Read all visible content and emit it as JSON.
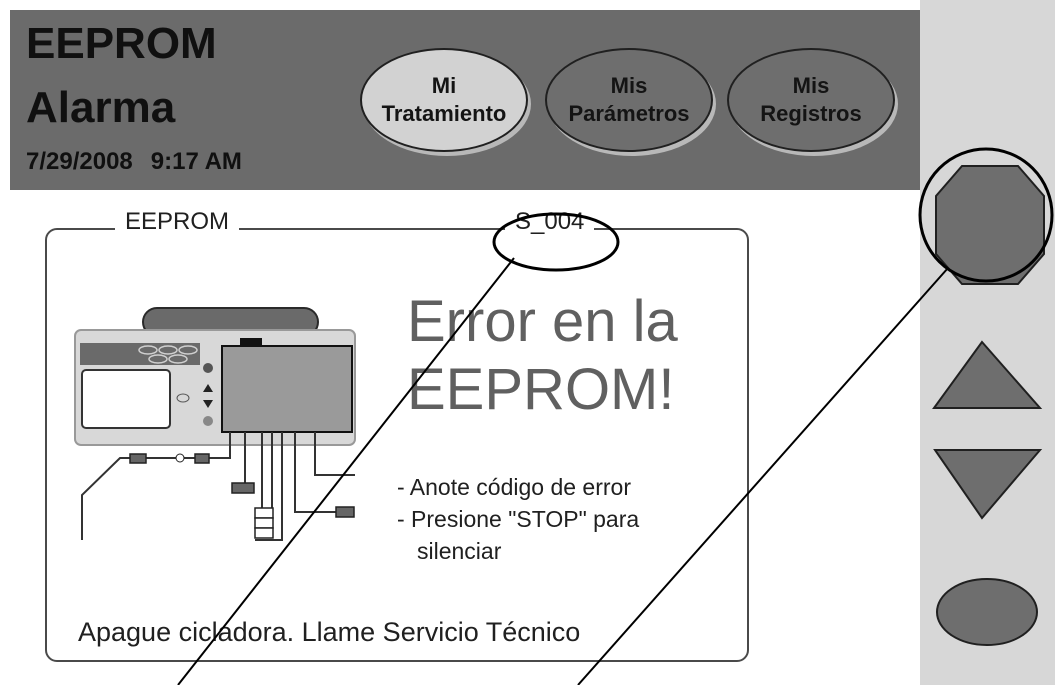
{
  "header": {
    "title_line1": "EEPROM",
    "title_line2": "Alarma",
    "date": "7/29/2008",
    "time": "9:17 AM"
  },
  "tabs": [
    {
      "line1": "Mi",
      "line2": "Tratamiento",
      "active": true
    },
    {
      "line1": "Mis",
      "line2": "Parámetros",
      "active": false
    },
    {
      "line1": "Mis",
      "line2": "Registros",
      "active": false
    }
  ],
  "panel": {
    "legend_left": "EEPROM",
    "legend_code": "S_004",
    "error_line1": "Error en la",
    "error_line2": "EEPROM!",
    "instruction1": "- Anote código de error",
    "instruction2": "- Presione \"STOP\" para",
    "instruction3": "silenciar",
    "footer": "Apague cicladora.  Llame Servicio Técnico"
  },
  "side_buttons": {
    "stop_icon": "octagon-stop-icon",
    "up_icon": "triangle-up-icon",
    "down_icon": "triangle-down-icon",
    "enter_icon": "oval-enter-icon"
  },
  "colors": {
    "header_bg": "#6b6b6b",
    "side_bg": "#d7d7d7",
    "button_gray": "#6e6e6e",
    "active_tab": "#d2d2d2"
  }
}
